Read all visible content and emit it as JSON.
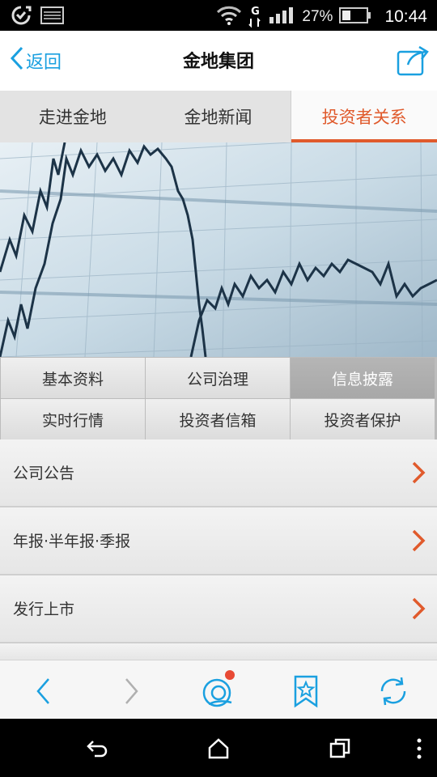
{
  "status_bar": {
    "network_label": "G",
    "battery_percent": "27%",
    "time": "10:44",
    "icons": [
      "sync-icon",
      "image-icon",
      "wifi-icon",
      "network-G-icon",
      "signal-icon",
      "battery-icon"
    ]
  },
  "header": {
    "back_label": "返回",
    "title": "金地集团",
    "share_icon": "share-icon"
  },
  "tabs": [
    {
      "label": "走进金地",
      "active": false
    },
    {
      "label": "金地新闻",
      "active": false
    },
    {
      "label": "投资者关系",
      "active": true
    }
  ],
  "banner": {
    "image": "stock-chart-photo"
  },
  "grid_menu": [
    {
      "label": "基本资料",
      "active": false
    },
    {
      "label": "公司治理",
      "active": false
    },
    {
      "label": "信息披露",
      "active": true
    },
    {
      "label": "实时行情",
      "active": false
    },
    {
      "label": "投资者信箱",
      "active": false
    },
    {
      "label": "投资者保护",
      "active": false
    }
  ],
  "list_items": [
    {
      "label": "公司公告"
    },
    {
      "label": "年报·半年报·季报"
    },
    {
      "label": "发行上市"
    }
  ],
  "toolbar": {
    "icons": [
      "back-arrow-icon",
      "forward-arrow-icon",
      "home-icon",
      "bookmark-icon",
      "refresh-icon"
    ]
  },
  "nav_bar": {
    "icons": [
      "system-back-icon",
      "system-home-icon",
      "recent-apps-icon",
      "more-icon"
    ]
  },
  "colors": {
    "accent": "#e05a2c",
    "link_blue": "#1aa0e0",
    "chevron": "#e05a2c"
  }
}
